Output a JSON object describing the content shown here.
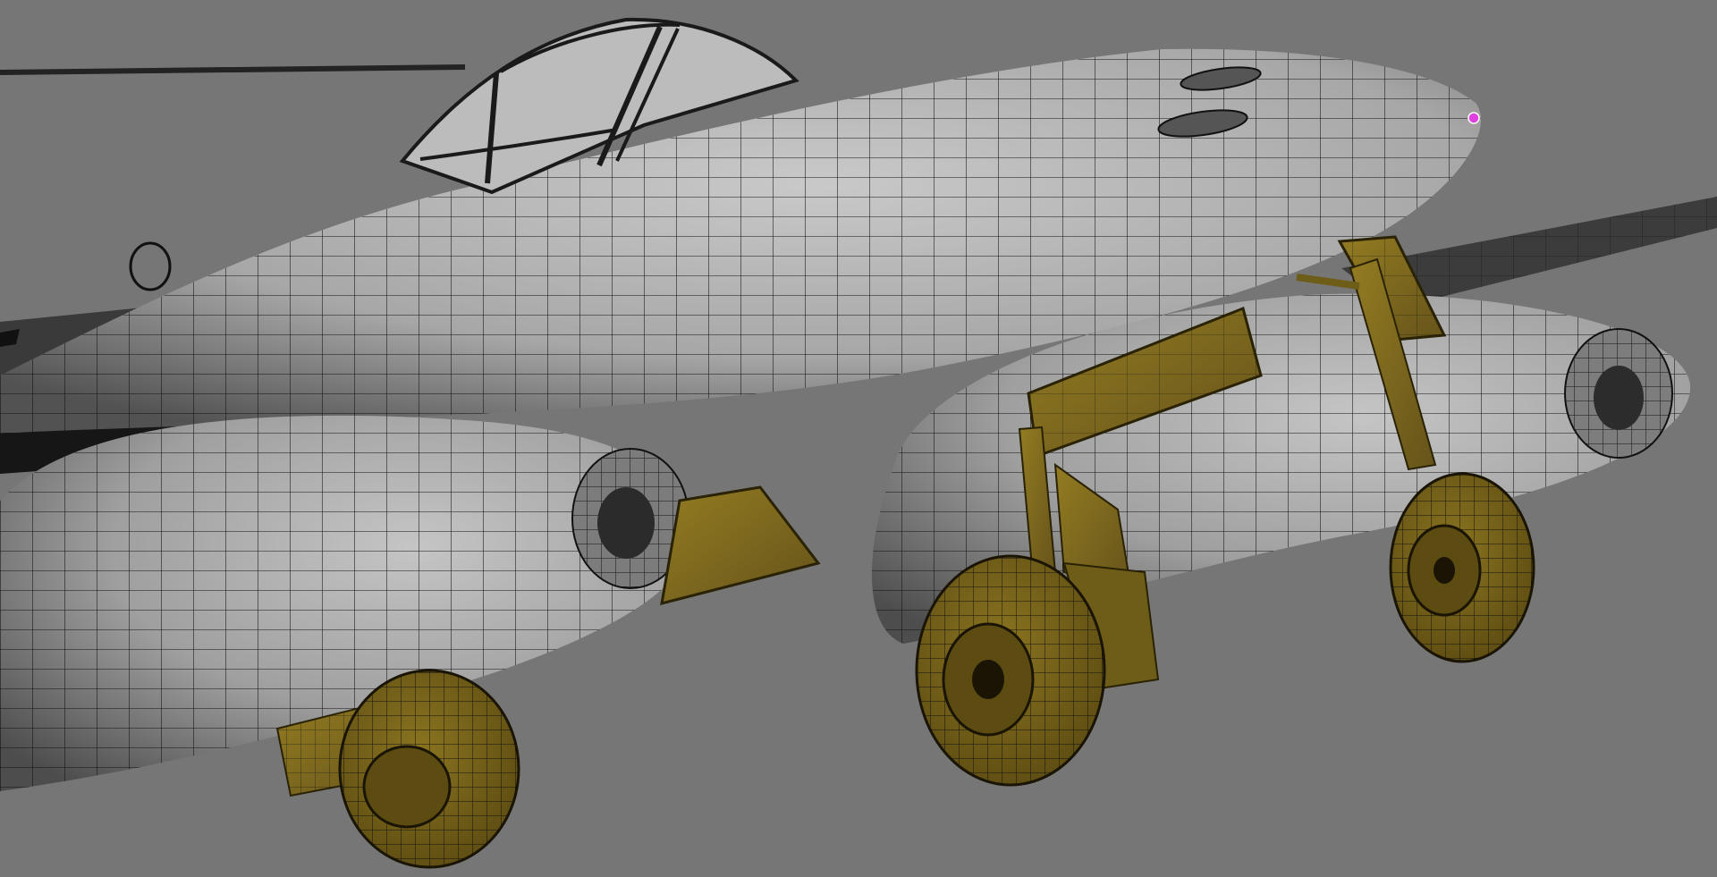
{
  "viewport": {
    "background": "#767676",
    "shading": "wireframe-on-shaded",
    "model": {
      "body_color": "#a9a9a9",
      "gear_color": "#8b7620",
      "wire_color": "#111111"
    },
    "objects": [
      {
        "name": "fuselage"
      },
      {
        "name": "cockpit-canopy"
      },
      {
        "name": "left-wing"
      },
      {
        "name": "right-wing"
      },
      {
        "name": "left-engine-nacelle"
      },
      {
        "name": "right-engine-nacelle"
      },
      {
        "name": "nose-landing-gear"
      },
      {
        "name": "main-landing-gear-left"
      },
      {
        "name": "main-landing-gear-right"
      },
      {
        "name": "gear-doors"
      },
      {
        "name": "selected-vertex",
        "color": "#e040e0"
      }
    ]
  }
}
